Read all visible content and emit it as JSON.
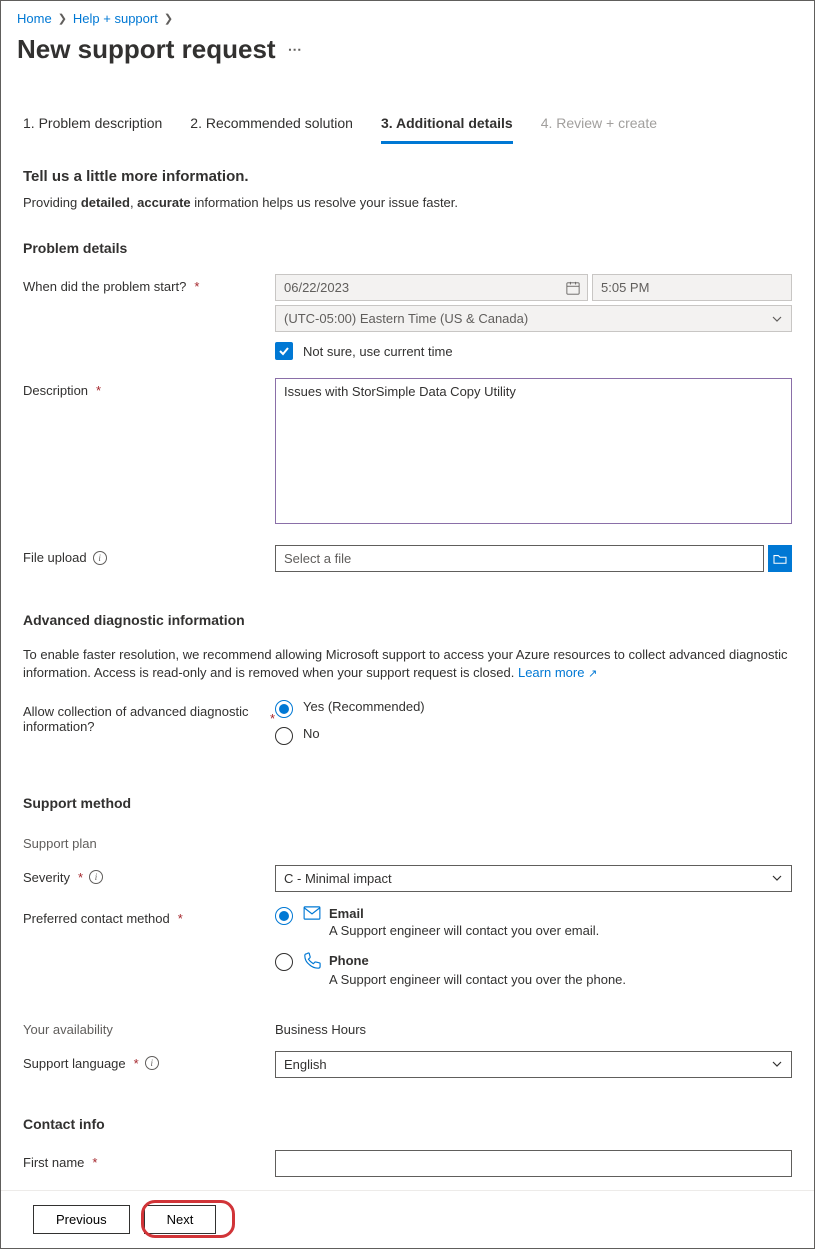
{
  "breadcrumb": {
    "home": "Home",
    "help": "Help + support"
  },
  "page": {
    "title": "New support request"
  },
  "tabs": [
    {
      "label": "1. Problem description",
      "state": "default"
    },
    {
      "label": "2. Recommended solution",
      "state": "default"
    },
    {
      "label": "3. Additional details",
      "state": "active"
    },
    {
      "label": "4. Review + create",
      "state": "disabled"
    }
  ],
  "intro": {
    "heading": "Tell us a little more information.",
    "prefix": "Providing ",
    "strong1": "detailed",
    "sep": ", ",
    "strong2": "accurate",
    "suffix": " information helps us resolve your issue faster."
  },
  "problem": {
    "section_title": "Problem details",
    "start_label": "When did the problem start?",
    "date_value": "06/22/2023",
    "time_value": "5:05 PM",
    "timezone_value": "(UTC-05:00) Eastern Time (US & Canada)",
    "not_sure_label": "Not sure, use current time",
    "description_label": "Description",
    "description_value": "Issues with StorSimple Data Copy Utility",
    "file_upload_label": "File upload",
    "file_placeholder": "Select a file"
  },
  "diagnostic": {
    "section_title": "Advanced diagnostic information",
    "paragraph_text": "To enable faster resolution, we recommend allowing Microsoft support to access your Azure resources to collect advanced diagnostic information. Access is read-only and is removed when your support request is closed. ",
    "learn_more": "Learn more",
    "allow_label": "Allow collection of advanced diagnostic information?",
    "yes_label": "Yes (Recommended)",
    "no_label": "No"
  },
  "support": {
    "section_title": "Support method",
    "plan_label": "Support plan",
    "severity_label": "Severity",
    "severity_value": "C - Minimal impact",
    "contact_label": "Preferred contact method",
    "email_label": "Email",
    "email_desc": "A Support engineer will contact you over email.",
    "phone_label": "Phone",
    "phone_desc": "A Support engineer will contact you over the phone.",
    "availability_label": "Your availability",
    "availability_value": "Business Hours",
    "language_label": "Support language",
    "language_value": "English"
  },
  "contact_info": {
    "section_title": "Contact info",
    "first_name_label": "First name"
  },
  "footer": {
    "previous": "Previous",
    "next": "Next"
  }
}
